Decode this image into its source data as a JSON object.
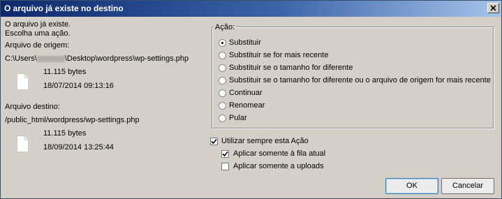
{
  "dialog": {
    "title": "O arquivo já existe no destino",
    "close_icon": "close-icon"
  },
  "message": {
    "line1": "O arquivo já existe.",
    "line2": "Escolha uma ação."
  },
  "source": {
    "label": "Arquivo de origem:",
    "path_prefix": "C:\\Users\\",
    "path_suffix": "\\Desktop\\wordpress\\wp-settings.php",
    "size": "11.115 bytes",
    "date": "18/07/2014 09:13:16",
    "icon": "file-icon"
  },
  "destination": {
    "label": "Arquivo destino:",
    "path": "/public_html/wordpress/wp-settings.php",
    "size": "11.115 bytes",
    "date": "18/09/2014 13:25:44",
    "icon": "file-icon"
  },
  "action_group": {
    "label": "Ação:",
    "selected": "Substituir",
    "options": [
      "Substituir",
      "Substituir se for mais recente",
      "Substituir se o tamanho for diferente",
      "Substituir se o tamanho for diferente ou o arquivo de origem for mais recente",
      "Continuar",
      "Renomear",
      "Pular"
    ]
  },
  "always_use": {
    "label": "Utilizar sempre esta Ação",
    "checked": true
  },
  "apply_queue": {
    "label": "Aplicar somente à fila atual",
    "checked": true
  },
  "apply_uploads": {
    "label": "Aplicar somente a uploads",
    "checked": false
  },
  "buttons": {
    "ok": "OK",
    "cancel": "Cancelar"
  },
  "colors": {
    "title_start": "#0d296c",
    "title_end": "#a6c4ea",
    "dialog_bg": "#d4d0c8"
  }
}
